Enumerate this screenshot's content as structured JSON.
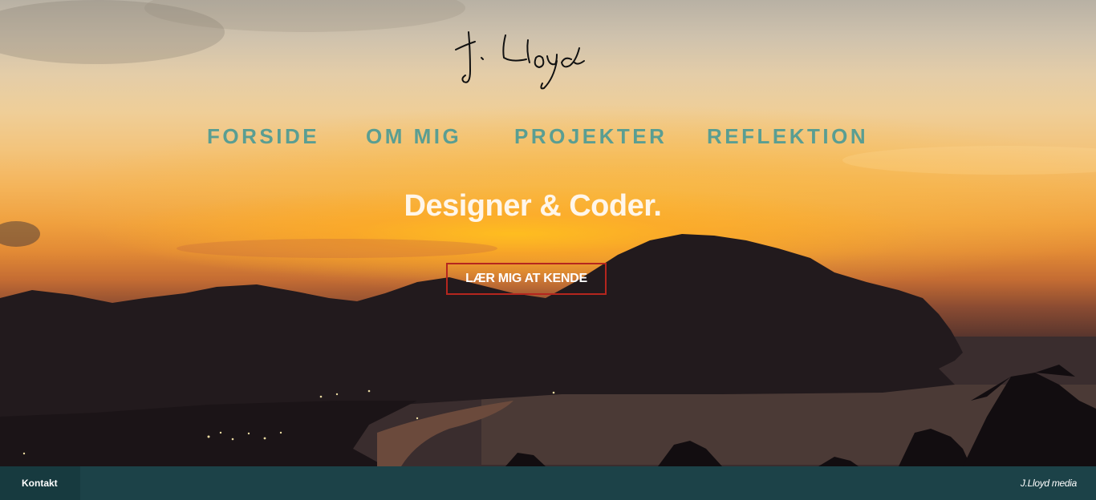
{
  "brand": {
    "signature": "J. Lloyd"
  },
  "nav": {
    "items": [
      {
        "label": "FORSIDE"
      },
      {
        "label": "OM MIG"
      },
      {
        "label": "PROJEKTER"
      },
      {
        "label": "REFLEKTION"
      }
    ],
    "color": "#5a9e92"
  },
  "hero": {
    "headline": "Designer & Coder.",
    "cta_label": "LÆR MIG AT KENDE",
    "cta_border_color": "#b5261e"
  },
  "footer": {
    "contact_label": "Kontakt",
    "brand_label": "J.Lloyd media",
    "background": "#1c4248"
  }
}
